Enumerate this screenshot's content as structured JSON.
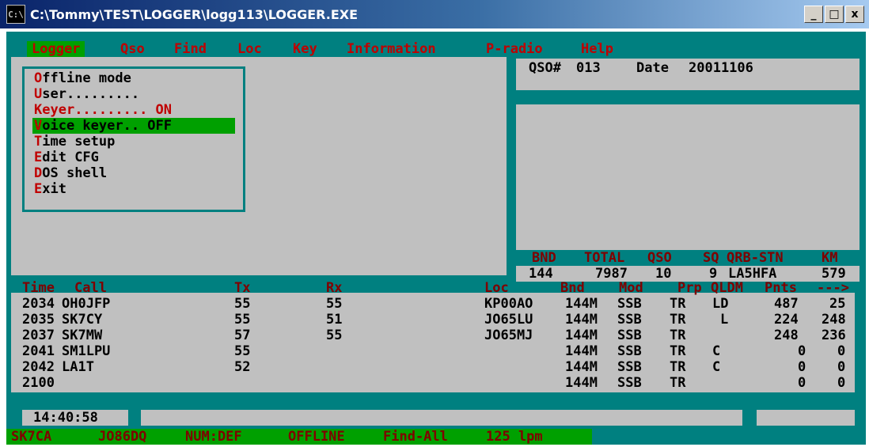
{
  "window": {
    "title": "C:\\Tommy\\TEST\\LOGGER\\logg113\\LOGGER.EXE",
    "app_icon": "console-icon",
    "buttons": {
      "minimize": "_",
      "maximize": "□",
      "close": "x"
    }
  },
  "menubar": [
    "Logger",
    "Qso",
    "Find",
    "Loc",
    "Key",
    "Information",
    "P-radio",
    "Help"
  ],
  "logger_menu": [
    {
      "hotkey": "O",
      "rest": "ffline mode"
    },
    {
      "hotkey": "U",
      "rest": "ser........."
    },
    {
      "hotkey": "K",
      "rest": "eyer......... ON"
    },
    {
      "hotkey": "V",
      "rest": "oice keyer.. OFF"
    },
    {
      "hotkey": "T",
      "rest": "ime setup"
    },
    {
      "hotkey": "E",
      "rest": "dit CFG"
    },
    {
      "hotkey": "D",
      "rest": "OS shell"
    },
    {
      "hotkey": "E",
      "rest": "xit"
    }
  ],
  "qso_info": {
    "qso_label": "QSO#",
    "qso_number": "013",
    "date_label": "Date",
    "date": "20011106"
  },
  "stats": {
    "headers": [
      "BND",
      "TOTAL",
      "QSO",
      "SQ",
      "QRB-STN",
      "KM"
    ],
    "values": [
      "144",
      "7987",
      "10",
      "9",
      "LA5HFA",
      "579"
    ]
  },
  "log": {
    "headers": [
      "Time",
      "Call",
      "Tx",
      "Rx",
      "Loc",
      "Bnd",
      "Mod",
      "Prp",
      "QLDM",
      "Pnts",
      "--->"
    ],
    "rows": [
      {
        "time": "2034",
        "call": "OH0JFP",
        "tx": "55",
        "rx": "55",
        "loc": "KP00AO",
        "bnd": "144M",
        "mod": "SSB",
        "prp": "TR",
        "qldm": "LD",
        "pnts": "487",
        "extra": "25"
      },
      {
        "time": "2035",
        "call": "SK7CY",
        "tx": "55",
        "rx": "51",
        "loc": "JO65LU",
        "bnd": "144M",
        "mod": "SSB",
        "prp": "TR",
        "qldm": "L",
        "pnts": "224",
        "extra": "248"
      },
      {
        "time": "2037",
        "call": "SK7MW",
        "tx": "57",
        "rx": "55",
        "loc": "JO65MJ",
        "bnd": "144M",
        "mod": "SSB",
        "prp": "TR",
        "qldm": "",
        "pnts": "248",
        "extra": "236"
      },
      {
        "time": "2041",
        "call": "SM1LPU",
        "tx": "55",
        "rx": "",
        "loc": "",
        "bnd": "144M",
        "mod": "SSB",
        "prp": "TR",
        "qldm": "C",
        "pnts": "0",
        "extra": "0"
      },
      {
        "time": "2042",
        "call": "LA1T",
        "tx": "52",
        "rx": "",
        "loc": "",
        "bnd": "144M",
        "mod": "SSB",
        "prp": "TR",
        "qldm": "C",
        "pnts": "0",
        "extra": "0"
      },
      {
        "time": "2100",
        "call": "",
        "tx": "",
        "rx": "",
        "loc": "",
        "bnd": "144M",
        "mod": "SSB",
        "prp": "TR",
        "qldm": "",
        "pnts": "0",
        "extra": "0"
      }
    ]
  },
  "clock": "14:40:58",
  "statusbar": [
    "SK7CA",
    "JO86DQ",
    "NUM:DEF",
    "OFFLINE",
    "Find-All",
    "125 lpm"
  ],
  "colors": {
    "background": "#008080",
    "panel": "#c0c0c0",
    "highlight": "#00a000",
    "hotkey": "#c00000",
    "header": "#800000"
  }
}
